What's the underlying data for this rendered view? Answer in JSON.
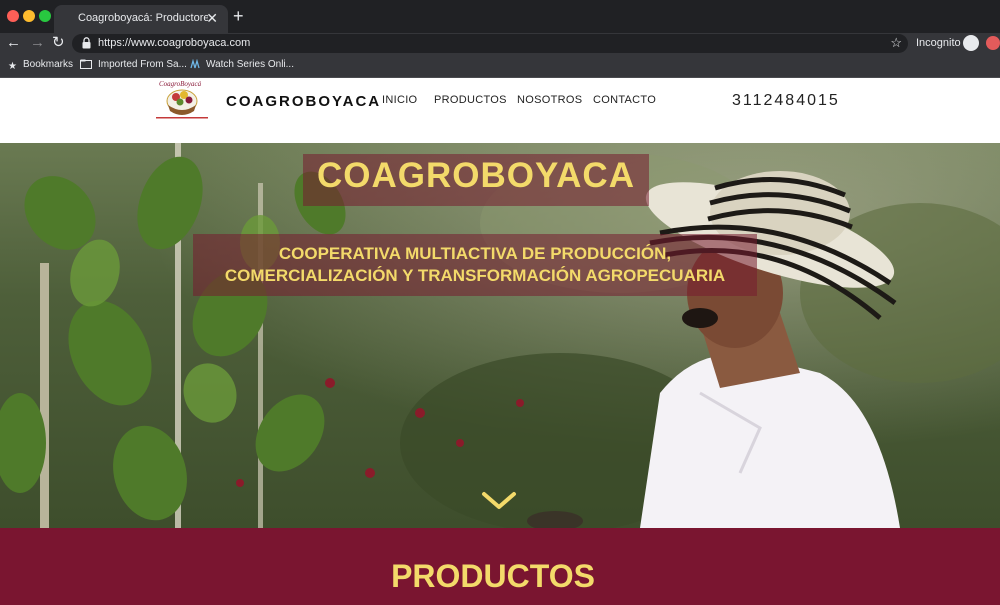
{
  "browser": {
    "tab_title": "Coagroboyacá: Productores de",
    "url": "https://www.coagroboyaca.com",
    "incognito_label": "Incognito",
    "bookmarks": [
      {
        "label": "Bookmarks",
        "icon": "star-icon"
      },
      {
        "label": "Imported From Sa...",
        "icon": "folder-icon"
      },
      {
        "label": "Watch Series Onli...",
        "icon": "site-icon"
      }
    ]
  },
  "header": {
    "logo_text": "CoagroBoyacá",
    "brand": "COAGROBOYACA",
    "nav": [
      "INICIO",
      "PRODUCTOS",
      "NOSOTROS",
      "CONTACTO"
    ],
    "phone": "3112484015"
  },
  "hero": {
    "title": "COAGROBOYACA",
    "subtitle_line1": "COOPERATIVA MULTIACTIVA DE PRODUCCIÓN,",
    "subtitle_line2": "COMERCIALIZACIÓN Y TRANSFORMACIÓN AGROPECUARIA"
  },
  "products": {
    "title": "PRODUCTOS"
  },
  "colors": {
    "accent_gold": "#f3da6a",
    "brand_maroon": "#7a1530"
  }
}
